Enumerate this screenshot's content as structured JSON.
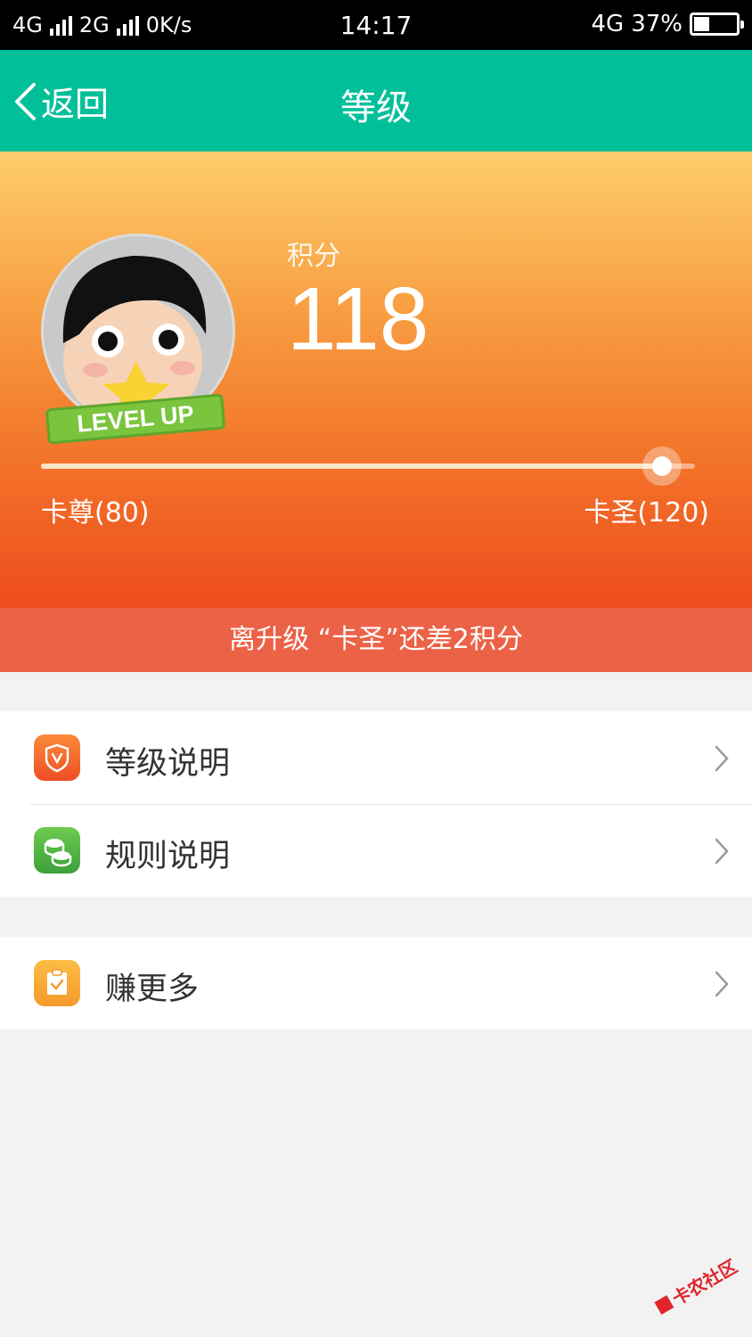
{
  "status_bar": {
    "network1": "4G",
    "network2": "2G",
    "speed": "0K/s",
    "time": "14:17",
    "network3": "4G",
    "battery_text": "37%",
    "battery_level": 0.37
  },
  "nav": {
    "back_label": "返回",
    "title": "等级"
  },
  "hero": {
    "badge_text": "LEVEL UP",
    "score_label": "积分",
    "score_value": "118",
    "progress": 0.95,
    "current_level": "卡尊(80)",
    "next_level": "卡圣(120)"
  },
  "hint": {
    "text": "离升级 “卡圣”还差2积分"
  },
  "menu": {
    "group1": [
      {
        "label": "等级说明",
        "icon": "shield-icon",
        "color": "#f4622f"
      },
      {
        "label": "规则说明",
        "icon": "coins-icon",
        "color": "#52b848"
      }
    ],
    "group2": [
      {
        "label": "赚更多",
        "icon": "clipboard-check-icon",
        "color": "#f8a93a"
      }
    ]
  },
  "colors": {
    "nav_bg": "#00bf99",
    "hint_bg": "#ec6247",
    "gradient_top": "#fdcd6d",
    "gradient_bottom": "#ee4c1d"
  },
  "watermark": {
    "text": "卡农社区"
  }
}
